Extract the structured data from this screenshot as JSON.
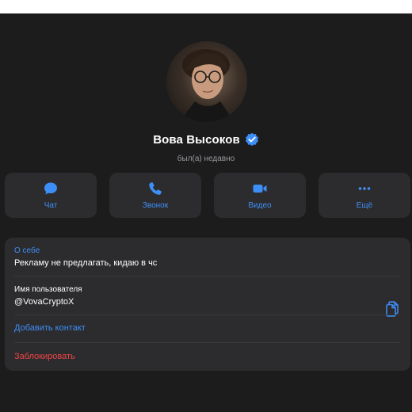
{
  "profile": {
    "name": "Вова Высоков",
    "status": "был(а) недавно",
    "verified_icon": "verified-badge-icon",
    "avatar": "profile-photo"
  },
  "actions": [
    {
      "label": "Чат",
      "icon": "chat-bubble-icon"
    },
    {
      "label": "Звонок",
      "icon": "phone-icon"
    },
    {
      "label": "Видео",
      "icon": "video-camera-icon"
    },
    {
      "label": "Ещё",
      "icon": "more-dots-icon"
    }
  ],
  "info": {
    "bio_label": "О себе",
    "bio_value": "Рекламу не предлагать, кидаю в чс",
    "username_label": "Имя пользователя",
    "username_value": "@VovaCryptoX",
    "add_contact": "Добавить контакт",
    "block": "Заблокировать"
  },
  "colors": {
    "background": "#1c1c1d",
    "card": "#2c2c2e",
    "accent": "#3e8ef7",
    "danger": "#ef4444",
    "secondary_text": "#98989e"
  }
}
